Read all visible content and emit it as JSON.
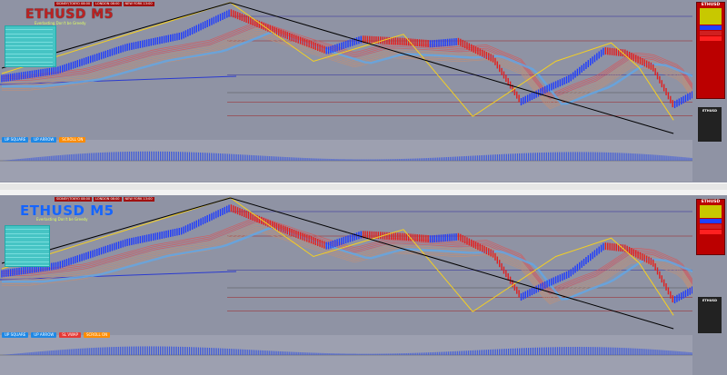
{
  "top": {
    "title": "ETHUSD M5",
    "subtitle": "Everlasting Don't be Greedy",
    "sessions": [
      "SIDNEY/TOKYO 08:00",
      "LONDON 08:00",
      "NEW YORK 13:00"
    ],
    "stats": [
      [
        "",
        "",
        "",
        ""
      ],
      [
        "",
        "",
        "",
        ""
      ],
      [
        "",
        "",
        "",
        ""
      ],
      [
        "",
        "",
        "",
        ""
      ],
      [
        "",
        "",
        "",
        ""
      ],
      [
        "",
        "",
        "",
        ""
      ],
      [
        "",
        "",
        "",
        ""
      ],
      [
        "",
        "",
        "",
        ""
      ],
      [
        "",
        "",
        "",
        ""
      ],
      [
        "",
        "",
        "",
        ""
      ]
    ],
    "buttons": [
      {
        "label": "UP SQUARE",
        "color": "#1e88e5"
      },
      {
        "label": "UP ARROW",
        "color": "#1e88e5"
      },
      {
        "label": "SCROLL ON",
        "color": "#ff8c00"
      }
    ],
    "panel": {
      "symbol": "ETHUSD"
    },
    "info_label": "ETHUSD"
  },
  "bottom": {
    "title": "ETHUSD M5",
    "subtitle": "Everlasting Don't be Greedy",
    "sessions": [
      "SIDNEY/TOKYO 08:00",
      "LONDON 08:00",
      "NEW YORK 13:00"
    ],
    "buttons": [
      {
        "label": "UP SQUARE",
        "color": "#1e88e5"
      },
      {
        "label": "UP ARROW",
        "color": "#1e88e5"
      },
      {
        "label": "SL VWAP",
        "color": "#e53935"
      },
      {
        "label": "SCROLL ON",
        "color": "#ff8c00"
      }
    ],
    "panel": {
      "symbol": "ETHUSD"
    },
    "info_label": "ETHUSD"
  },
  "colors": {
    "bg": "#8f93a4",
    "up": "#1e3cff",
    "down": "#e02020",
    "zigzag": "#f5d020",
    "trend": "#000000",
    "ribbon": "#d06a4a",
    "blueRibbon": "#5fa8e8"
  }
}
